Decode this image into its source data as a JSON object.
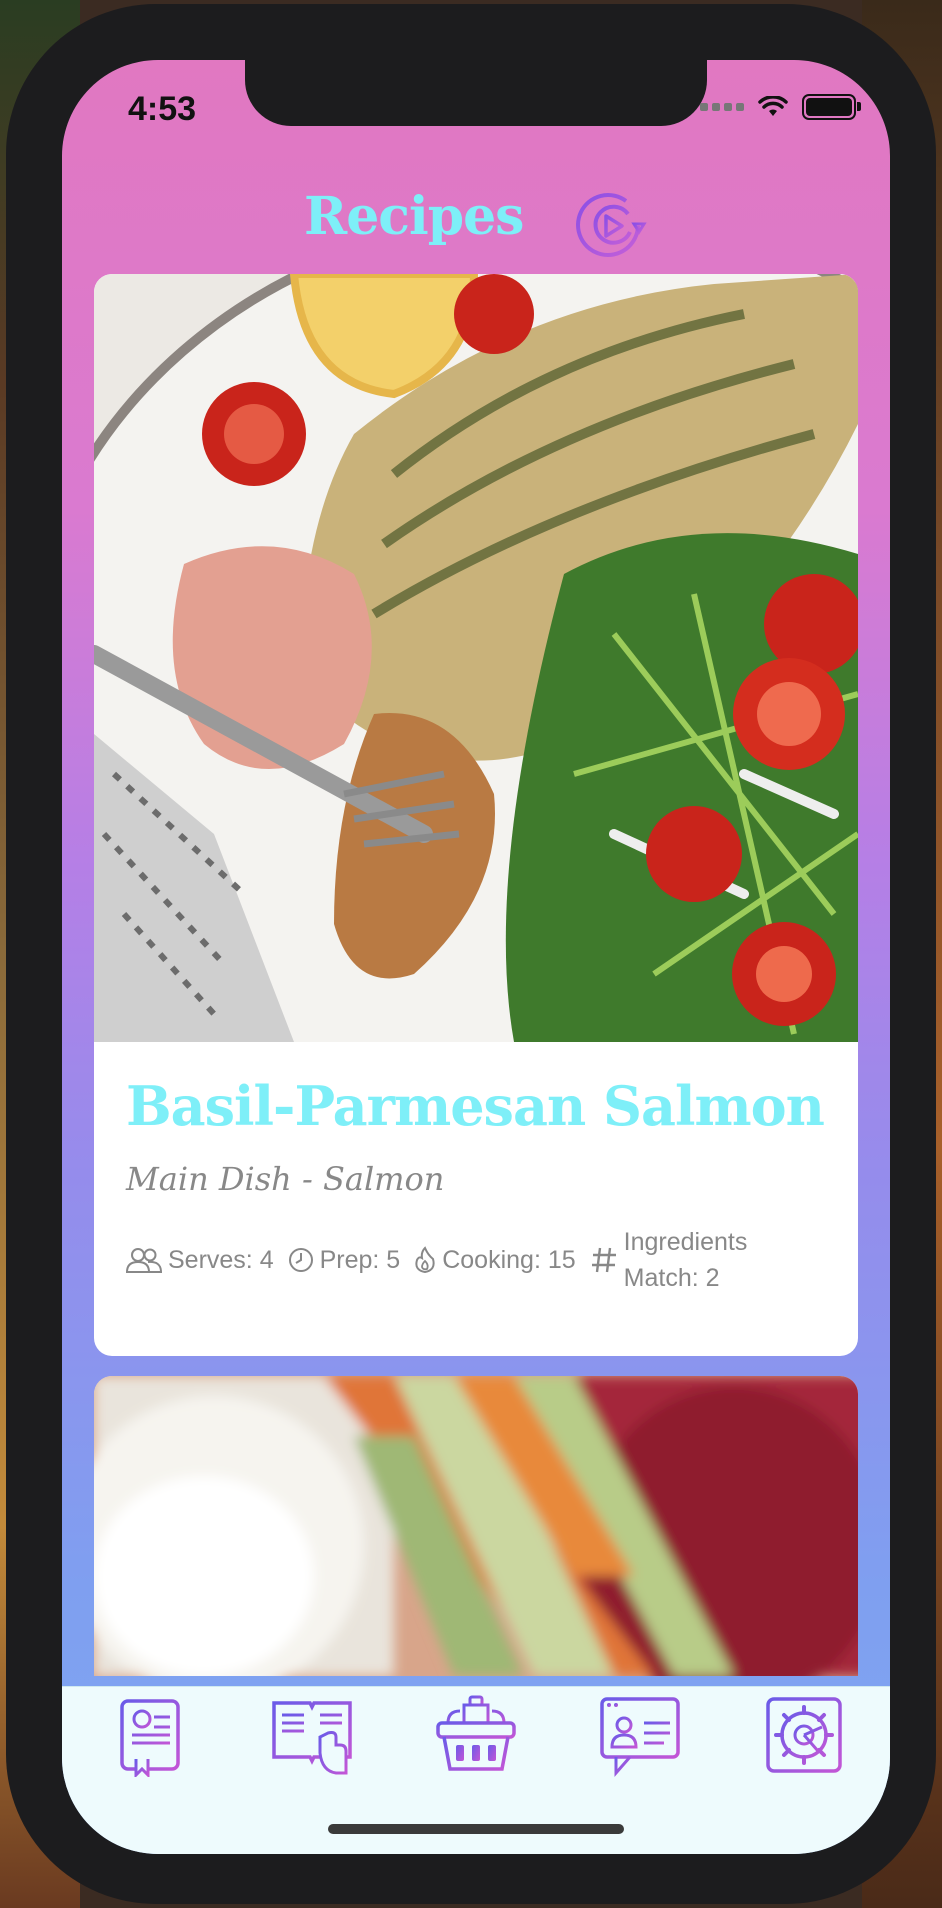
{
  "status_bar": {
    "time": "4:53"
  },
  "header": {
    "title": "Recipes",
    "refresh_icon": "refresh-icon"
  },
  "recipes": [
    {
      "title": "Basil-Parmesan Salmon",
      "subtitle": "Main Dish - Salmon",
      "image": "grilled-salmon-with-arugula-salad-photo",
      "meta": {
        "serves": "Serves: 4",
        "prep": "Prep: 5",
        "cooking": "Cooking: 15",
        "match_line1": "Ingredients",
        "match_line2": "Match: 2"
      }
    },
    {
      "image": "celery-carrots-and-dip-photo"
    }
  ],
  "tabbar": {
    "items": [
      {
        "icon": "recipe-book-icon"
      },
      {
        "icon": "open-cookbook-icon"
      },
      {
        "icon": "shopping-basket-icon"
      },
      {
        "icon": "profile-card-icon"
      },
      {
        "icon": "settings-gear-icon"
      }
    ]
  },
  "colors": {
    "accent": "#7eeff8",
    "icon": "#9b4fe0",
    "tabbar_bg": "#eefbfd"
  }
}
